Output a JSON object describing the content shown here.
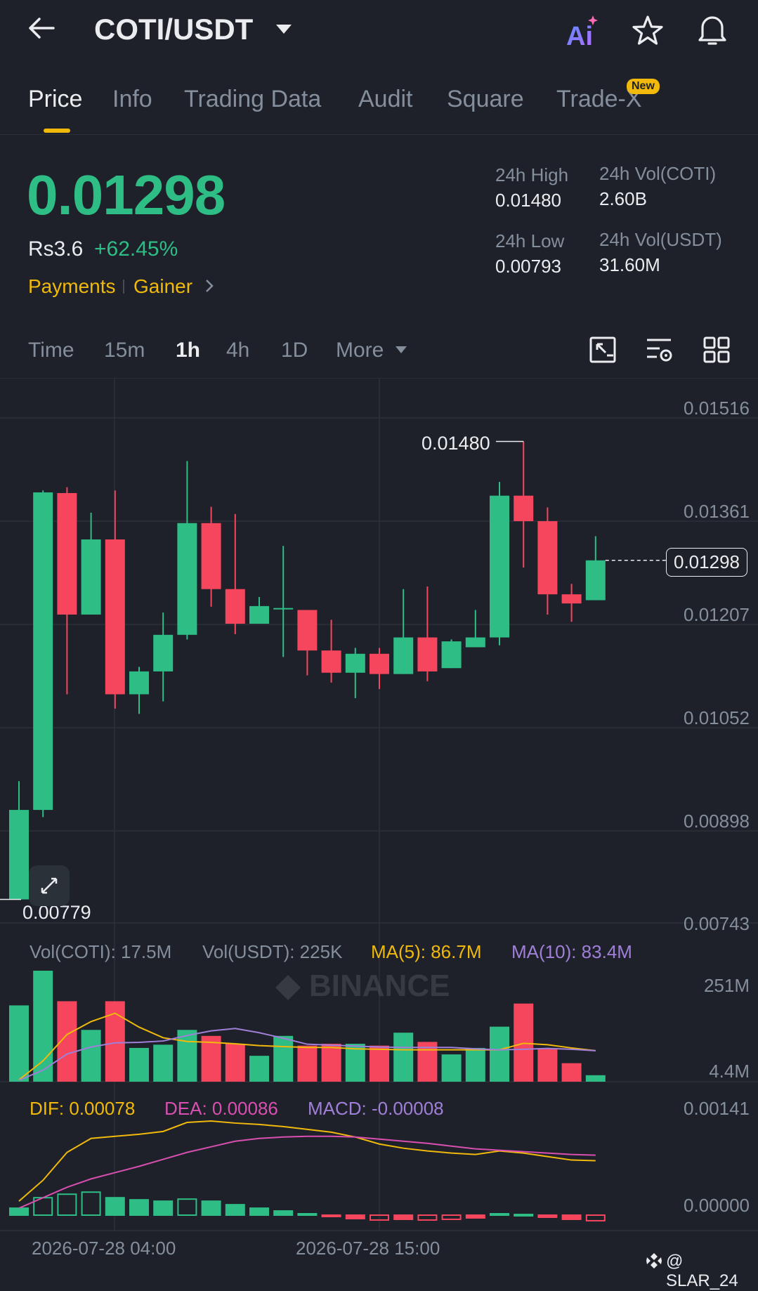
{
  "header": {
    "pair": "COTI/USDT",
    "icons": [
      "back-arrow-icon",
      "caret-down-icon",
      "ai-icon",
      "star-icon",
      "bell-icon"
    ]
  },
  "tabs": [
    {
      "label": "Price",
      "active": true
    },
    {
      "label": "Info"
    },
    {
      "label": "Trading Data"
    },
    {
      "label": "Audit"
    },
    {
      "label": "Square"
    },
    {
      "label": "Trade-X",
      "badge": "New"
    }
  ],
  "price": {
    "last": "0.01298",
    "fiat": "Rs3.6",
    "change": "+62.45%",
    "tag1": "Payments",
    "tag2": "Gainer"
  },
  "stats": {
    "high_label": "24h High",
    "high": "0.01480",
    "vol_coti_label": "24h Vol(COTI)",
    "vol_coti": "2.60B",
    "low_label": "24h Low",
    "low": "0.00793",
    "vol_usdt_label": "24h Vol(USDT)",
    "vol_usdt": "31.60M"
  },
  "timeframes": [
    "Time",
    "15m",
    "1h",
    "4h",
    "1D",
    "More"
  ],
  "active_timeframe": "1h",
  "chart_data": {
    "type": "candlestick",
    "y_ticks": [
      "0.01516",
      "0.01361",
      "0.01207",
      "0.01052",
      "0.00898",
      "0.00743"
    ],
    "ylim": [
      0.00743,
      0.01516
    ],
    "high_label": "0.01480",
    "low_label": "0.00779",
    "last_price_label": "0.01298",
    "candles": [
      {
        "o": 0.00779,
        "h": 0.0096,
        "l": 0.00779,
        "c": 0.00916
      },
      {
        "o": 0.00916,
        "h": 0.01405,
        "l": 0.00905,
        "c": 0.01402
      },
      {
        "o": 0.01401,
        "h": 0.0141,
        "l": 0.01093,
        "c": 0.01215
      },
      {
        "o": 0.01215,
        "h": 0.01371,
        "l": 0.01215,
        "c": 0.0133
      },
      {
        "o": 0.0133,
        "h": 0.01405,
        "l": 0.01071,
        "c": 0.01093
      },
      {
        "o": 0.01093,
        "h": 0.01135,
        "l": 0.01063,
        "c": 0.01128
      },
      {
        "o": 0.01128,
        "h": 0.01218,
        "l": 0.01082,
        "c": 0.01184
      },
      {
        "o": 0.01184,
        "h": 0.0145,
        "l": 0.01177,
        "c": 0.01355
      },
      {
        "o": 0.01355,
        "h": 0.0138,
        "l": 0.01227,
        "c": 0.01254
      },
      {
        "o": 0.01254,
        "h": 0.01369,
        "l": 0.01185,
        "c": 0.01201
      },
      {
        "o": 0.01201,
        "h": 0.01242,
        "l": 0.01201,
        "c": 0.01228
      },
      {
        "o": 0.01225,
        "h": 0.0132,
        "l": 0.0115,
        "c": 0.01225
      },
      {
        "o": 0.01222,
        "h": 0.01222,
        "l": 0.01122,
        "c": 0.0116
      },
      {
        "o": 0.0116,
        "h": 0.01207,
        "l": 0.01111,
        "c": 0.01126
      },
      {
        "o": 0.01126,
        "h": 0.01164,
        "l": 0.01087,
        "c": 0.01155
      },
      {
        "o": 0.01155,
        "h": 0.01164,
        "l": 0.01101,
        "c": 0.01124
      },
      {
        "o": 0.01124,
        "h": 0.01254,
        "l": 0.01124,
        "c": 0.0118
      },
      {
        "o": 0.0118,
        "h": 0.01258,
        "l": 0.01113,
        "c": 0.01128
      },
      {
        "o": 0.01133,
        "h": 0.01177,
        "l": 0.01133,
        "c": 0.01174
      },
      {
        "o": 0.01165,
        "h": 0.01222,
        "l": 0.01165,
        "c": 0.0118
      },
      {
        "o": 0.0118,
        "h": 0.01418,
        "l": 0.01168,
        "c": 0.01397
      },
      {
        "o": 0.01397,
        "h": 0.0148,
        "l": 0.01287,
        "c": 0.01358
      },
      {
        "o": 0.01358,
        "h": 0.01379,
        "l": 0.01215,
        "c": 0.01246
      },
      {
        "o": 0.01246,
        "h": 0.01262,
        "l": 0.01204,
        "c": 0.01232
      },
      {
        "o": 0.01237,
        "h": 0.01335,
        "l": 0.01237,
        "c": 0.01298
      }
    ],
    "volume": {
      "vol_coti_label": "Vol(COTI): 17.5M",
      "vol_usdt_label": "Vol(USDT): 225K",
      "ma5_label": "MA(5): 86.7M",
      "ma10_label": "MA(10): 83.4M",
      "y_ticks": [
        "251M",
        "4.4M"
      ],
      "values_m": [
        165,
        240,
        174,
        112,
        174,
        73,
        80,
        112,
        99,
        82,
        56,
        99,
        78,
        82,
        82,
        78,
        106,
        86,
        59,
        73,
        119,
        169,
        71,
        40,
        14
      ],
      "ma5_m": [
        4,
        45,
        102,
        130,
        148,
        118,
        95,
        87,
        85,
        82,
        78,
        76,
        74,
        74,
        71,
        70,
        69,
        69,
        69,
        69,
        69,
        83,
        80,
        73,
        67
      ],
      "ma10_m": [
        3,
        25,
        60,
        75,
        84,
        85,
        88,
        100,
        110,
        115,
        106,
        94,
        81,
        79,
        77,
        75,
        74,
        74,
        74,
        71,
        69,
        70,
        72,
        70,
        67
      ]
    },
    "macd": {
      "dif_label": "DIF: 0.00078",
      "dea_label": "DEA: 0.00086",
      "macd_label": "MACD: -0.00008",
      "y_ticks": [
        "0.00141",
        "0.00000"
      ],
      "dif": [
        0.0002,
        0.0005,
        0.0009,
        0.0011,
        0.00113,
        0.00116,
        0.0012,
        0.00133,
        0.00135,
        0.00132,
        0.0013,
        0.00127,
        0.00123,
        0.00119,
        0.00112,
        0.00102,
        0.00096,
        0.00092,
        0.00089,
        0.00087,
        0.00092,
        0.00089,
        0.00084,
        0.00079,
        0.00078
      ],
      "dea": [
        0.0001,
        0.00025,
        0.0004,
        0.00052,
        0.00061,
        0.0007,
        0.0008,
        0.0009,
        0.00098,
        0.00106,
        0.0011,
        0.00112,
        0.00113,
        0.00113,
        0.00112,
        0.00109,
        0.00106,
        0.00103,
        0.00099,
        0.00095,
        0.00093,
        0.00091,
        0.00089,
        0.00087,
        0.00086
      ],
      "hist": [
        0.0001,
        0.00025,
        0.0003,
        0.00033,
        0.00025,
        0.00022,
        0.0002,
        0.00023,
        0.0002,
        0.00015,
        0.0001,
        6e-05,
        2e-05,
        -2e-05,
        -5e-05,
        -7e-05,
        -6e-05,
        -7e-05,
        -6e-05,
        -4e-05,
        2e-05,
        1e-05,
        -3e-05,
        -6e-05,
        -8e-05
      ],
      "hist_hollow": [
        false,
        true,
        true,
        true,
        false,
        false,
        false,
        true,
        false,
        false,
        false,
        false,
        false,
        false,
        false,
        true,
        false,
        true,
        true,
        false,
        false,
        false,
        false,
        false,
        true
      ]
    },
    "x_ticks": [
      "2026-07-28 04:00",
      "2026-07-28 15:00"
    ]
  },
  "watermark": "@ SLAR_24",
  "colors": {
    "up": "#2ebd85",
    "down": "#f6465d",
    "accent": "#f0b90b",
    "bg": "#1e2129",
    "ma5": "#f0b90b",
    "ma10": "#a07fd9",
    "dea": "#d94fb1"
  }
}
